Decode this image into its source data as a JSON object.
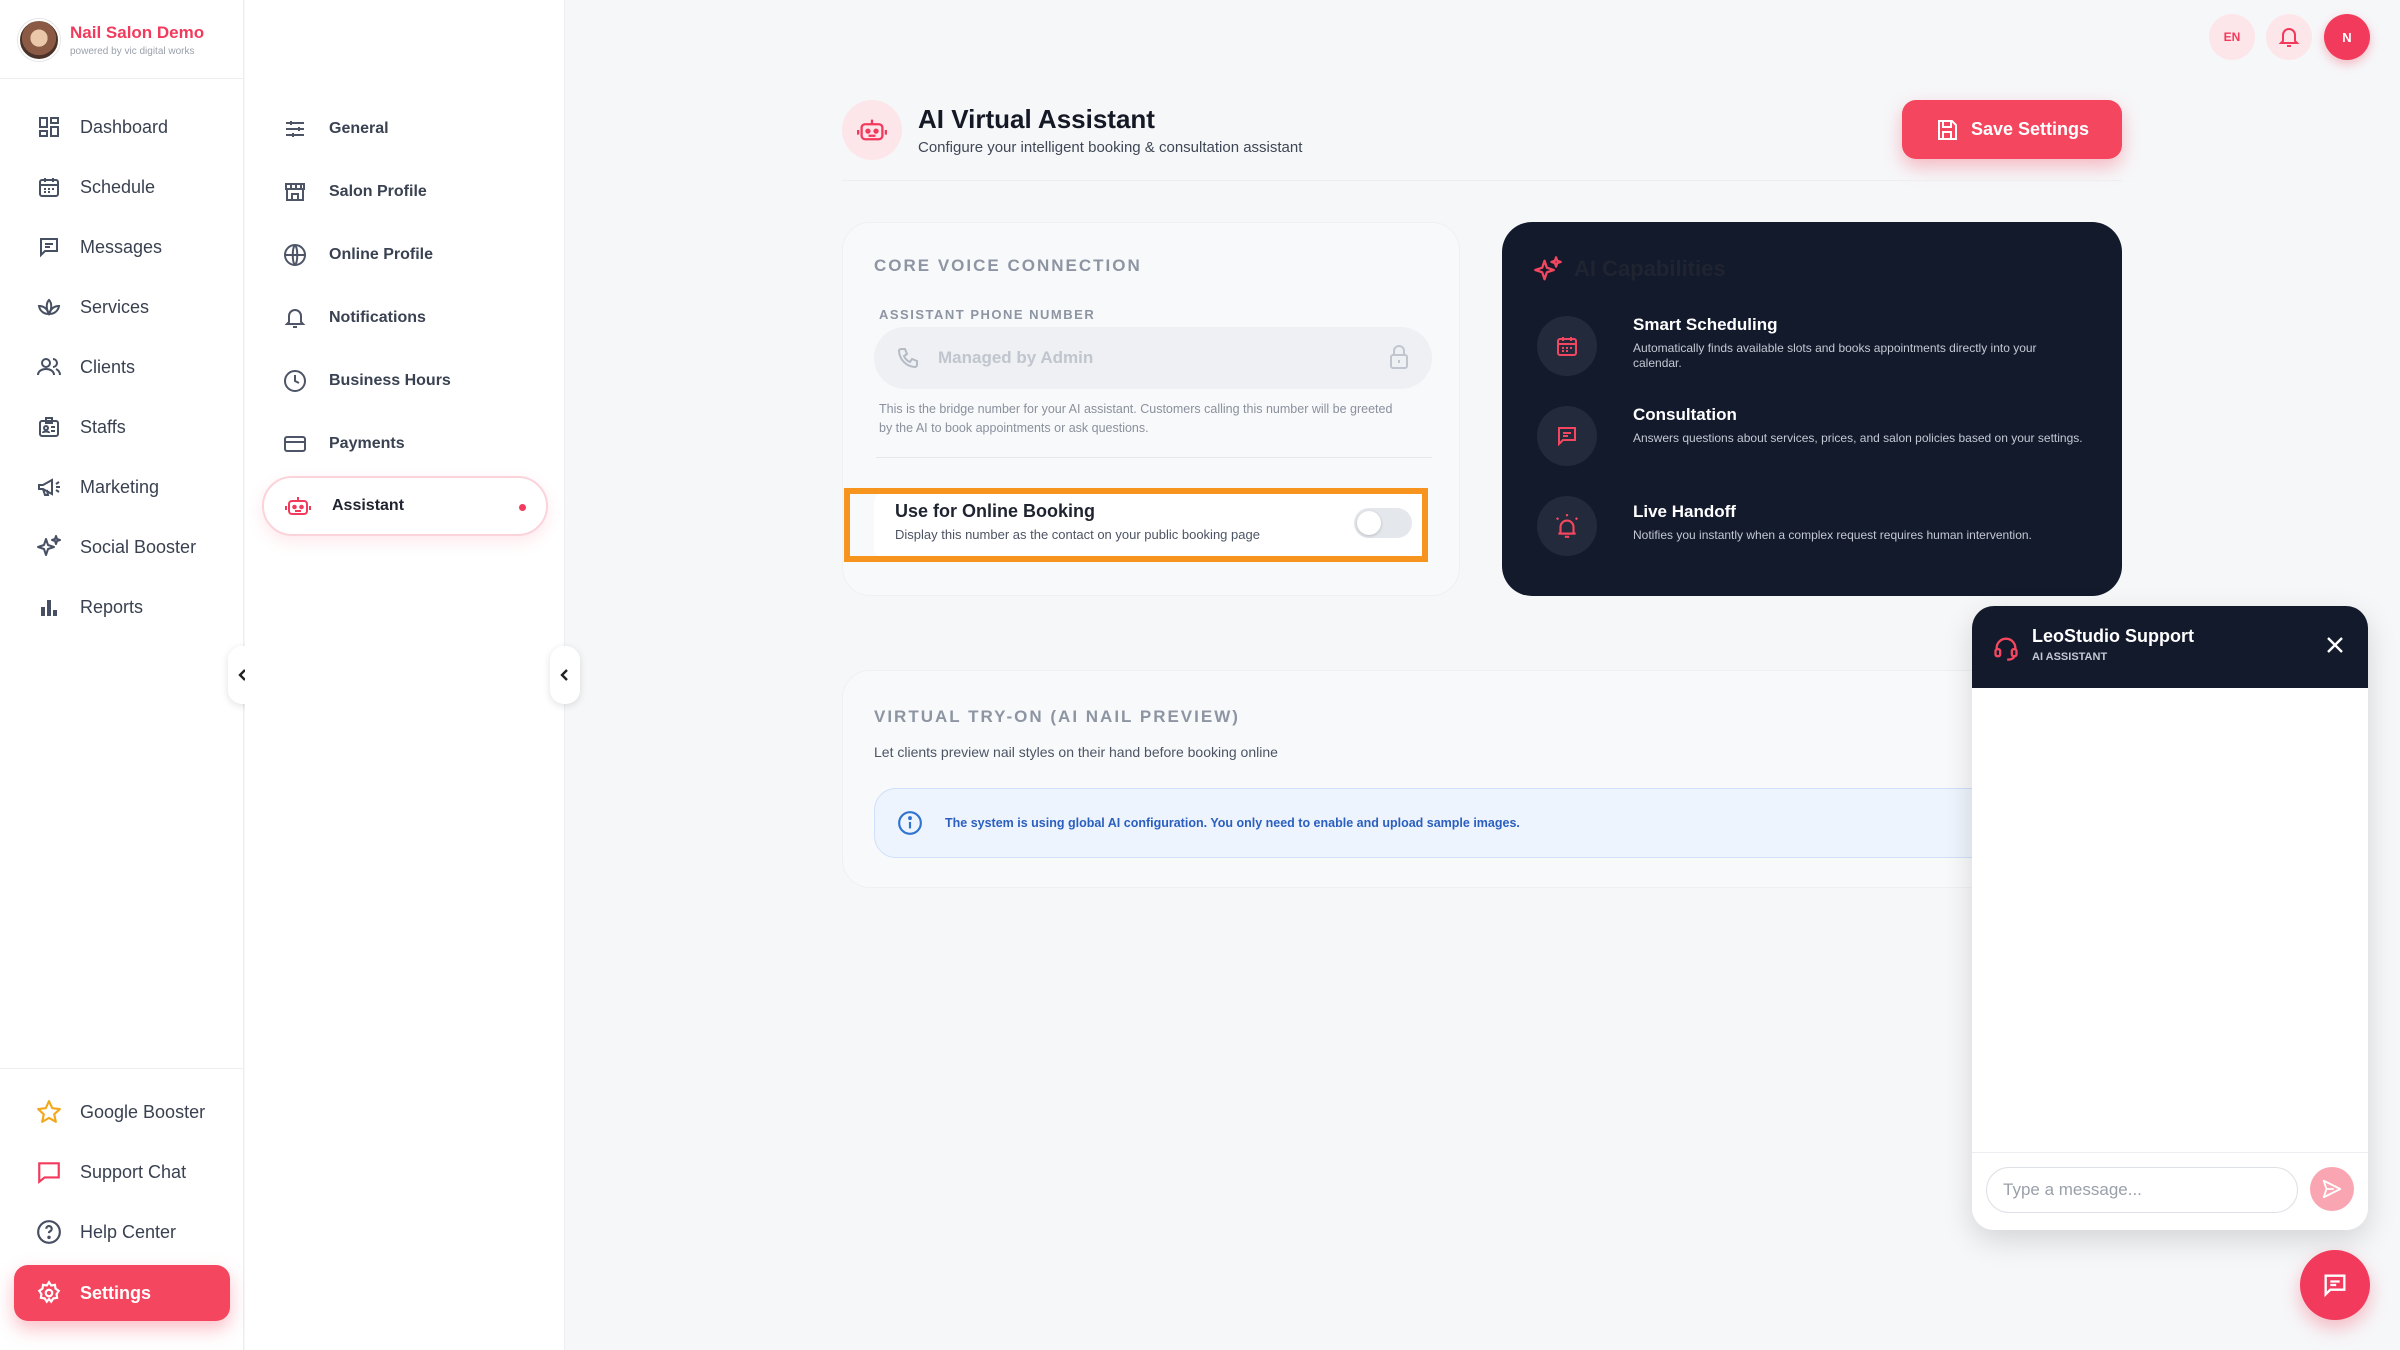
{
  "brand": {
    "name": "Nail Salon Demo",
    "tagline": "powered by vic digital works"
  },
  "sidebar": {
    "items": [
      {
        "label": "Dashboard",
        "icon": "dashboard-icon"
      },
      {
        "label": "Schedule",
        "icon": "calendar-icon"
      },
      {
        "label": "Messages",
        "icon": "message-icon"
      },
      {
        "label": "Services",
        "icon": "lotus-icon"
      },
      {
        "label": "Clients",
        "icon": "users-icon"
      },
      {
        "label": "Staffs",
        "icon": "id-badge-icon"
      },
      {
        "label": "Marketing",
        "icon": "megaphone-icon"
      },
      {
        "label": "Social Booster",
        "icon": "sparkles-icon"
      },
      {
        "label": "Reports",
        "icon": "bar-chart-icon"
      }
    ],
    "bottom_items": [
      {
        "label": "Google Booster",
        "icon": "star-icon"
      },
      {
        "label": "Support Chat",
        "icon": "chat-icon"
      },
      {
        "label": "Help Center",
        "icon": "help-icon"
      }
    ],
    "settings_label": "Settings"
  },
  "settings_nav": {
    "items": [
      {
        "label": "General",
        "icon": "sliders-icon"
      },
      {
        "label": "Salon Profile",
        "icon": "store-icon"
      },
      {
        "label": "Online Profile",
        "icon": "globe-icon"
      },
      {
        "label": "Notifications",
        "icon": "bell-icon"
      },
      {
        "label": "Business Hours",
        "icon": "clock-icon"
      },
      {
        "label": "Payments",
        "icon": "card-icon"
      }
    ],
    "active": {
      "label": "Assistant",
      "icon": "robot-icon"
    }
  },
  "topbar": {
    "lang": "EN",
    "avatar_initial": "N"
  },
  "header": {
    "title": "AI Virtual Assistant",
    "subtitle": "Configure your intelligent booking & consultation assistant",
    "save_label": "Save Settings"
  },
  "core_voice": {
    "title": "CORE VOICE CONNECTION",
    "phone_label": "ASSISTANT PHONE NUMBER",
    "phone_placeholder": "Managed by Admin",
    "help_text": "This is the bridge number for your AI assistant. Customers calling this number will be greeted by the AI to book appointments or ask questions.",
    "toggle_title": "Use for Online Booking",
    "toggle_desc": "Display this number as the contact on your public booking page",
    "toggle_on": false
  },
  "capabilities": {
    "title": "AI Capabilities",
    "items": [
      {
        "title": "Smart Scheduling",
        "desc": "Automatically finds available slots and books appointments directly into your calendar.",
        "icon": "calendar-icon"
      },
      {
        "title": "Consultation",
        "desc": "Answers questions about services, prices, and salon policies based on your settings.",
        "icon": "message-icon"
      },
      {
        "title": "Live Handoff",
        "desc": "Notifies you instantly when a complex request requires human intervention.",
        "icon": "alarm-icon"
      }
    ]
  },
  "virtual_tryon": {
    "title": "VIRTUAL TRY-ON (AI NAIL PREVIEW)",
    "subtitle": "Let clients preview nail styles on their hand before booking online",
    "info": "The system is using global AI configuration. You only need to enable and upload sample images."
  },
  "chat": {
    "title": "LeoStudio Support",
    "subtitle": "AI ASSISTANT",
    "input_placeholder": "Type a message..."
  },
  "colors": {
    "accent": "#f4475f",
    "dark_panel": "#131a2c",
    "highlight": "#f7941d"
  }
}
